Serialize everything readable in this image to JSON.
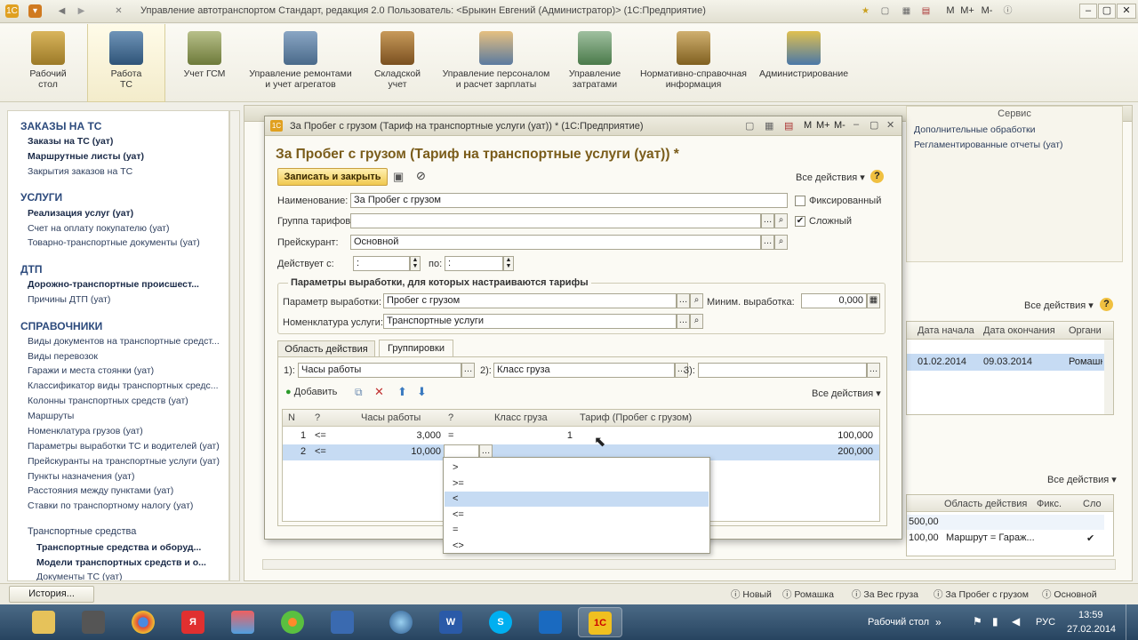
{
  "window": {
    "title": "Управление автотранспортом Стандарт, редакция 2.0    Пользователь: <Брыкин Евгений (Администратор)>    (1С:Предприятие)",
    "btn_m": "M",
    "btn_mplus": "M+",
    "btn_mminus": "M-",
    "logo": "1С"
  },
  "ribbon": [
    {
      "label1": "Рабочий",
      "label2": "стол"
    },
    {
      "label1": "Работа",
      "label2": "ТС"
    },
    {
      "label1": "Учет ГСМ",
      "label2": ""
    },
    {
      "label1": "Управление ремонтами",
      "label2": "и учет агрегатов"
    },
    {
      "label1": "Складской",
      "label2": "учет"
    },
    {
      "label1": "Управление персоналом",
      "label2": "и расчет зарплаты"
    },
    {
      "label1": "Управление",
      "label2": "затратами"
    },
    {
      "label1": "Нормативно-справочная",
      "label2": "информация"
    },
    {
      "label1": "Администрирование",
      "label2": ""
    }
  ],
  "nav": {
    "s1": "ЗАКАЗЫ НА ТС",
    "s1_i1": "Заказы на ТС (уат)",
    "s1_i2": "Маршрутные листы (уат)",
    "s1_i3": "Закрытия заказов на ТС",
    "s2": "УСЛУГИ",
    "s2_i1": "Реализация услуг (уат)",
    "s2_i2": "Счет на оплату покупателю (уат)",
    "s2_i3": "Товарно-транспортные документы (уат)",
    "s3": "ДТП",
    "s3_i1": "Дорожно-транспортные происшест...",
    "s3_i2": "Причины ДТП (уат)",
    "s4": "СПРАВОЧНИКИ",
    "refs": [
      "Виды документов на транспортные средст...",
      "Виды перевозок",
      "Гаражи и места стоянки (уат)",
      "Классификатор виды транспортных средс...",
      "Колонны транспортных средств (уат)",
      "Маршруты",
      "Номенклатура грузов (уат)",
      "Параметры выработки ТС и водителей (уат)",
      "Прейскуранты на транспортные услуги (уат)",
      "Пункты назначения (уат)",
      "Расстояния между пунктами (уат)",
      "Ставки по транспортному налогу (уат)"
    ],
    "s5": "Транспортные средства",
    "s5_i1": "Транспортные средства и оборуд...",
    "s5_i2": "Модели транспортных средств и о...",
    "s5_i3": "Документы ТС (уат)"
  },
  "bg": {
    "title": "За Пробег с грузом (Тариф на транспортные услуги (уат)) * (1С:Предприятие)",
    "service_title": "Сервис",
    "service_1": "Дополнительные обработки",
    "service_2": "Регламентированные отчеты (уат)",
    "all_actions": "Все действия",
    "cols1": [
      "Дата начала",
      "Дата окончания",
      "Органи"
    ],
    "row1": [
      "01.02.2014",
      "09.03.2014",
      "Ромашк"
    ],
    "all_actions2": "Все действия",
    "cols2": [
      "Область действия",
      "Фикс.",
      "Сло"
    ],
    "row2": [
      "500,00",
      "",
      ""
    ],
    "row3": [
      "100,00",
      "Маршрут = Гараж...",
      "✔"
    ]
  },
  "dlg": {
    "title": "За Пробег с грузом (Тариф на транспортные услуги (уат)) * (1С:Предприятие)",
    "heading": "За Пробег с грузом (Тариф на транспортные услуги (уат)) *",
    "save_close": "Записать и закрыть",
    "all_actions": "Все действия",
    "name_label": "Наименование:",
    "name_value": "За Пробег с грузом",
    "group_label": "Группа тарифов:",
    "group_value": "",
    "price_label": "Прейскурант:",
    "price_value": "Основной",
    "valid_label": "Действует с:",
    "valid_from": " :",
    "valid_to_label": "по:",
    "valid_to": " :",
    "fixed_label": "Фиксированный",
    "fixed_checked": false,
    "complex_label": "Сложный",
    "complex_checked": true,
    "params_group": "Параметры выработки, для которых настраиваются тарифы",
    "param_label": "Параметр выработки:",
    "param_value": "Пробег с грузом",
    "min_label": "Миним. выработка:",
    "min_value": "0,000",
    "service_label": "Номенклатура услуги:",
    "service_value": "Транспортные услуги",
    "tab1": "Область действия",
    "tab2": "Группировки",
    "g1_label": "1):",
    "g1_value": "Часы работы",
    "g2_label": "2):",
    "g2_value": "Класс груза",
    "g3_label": "3):",
    "g3_value": "",
    "add": "Добавить",
    "all_actions_tbl": "Все действия",
    "cols": [
      "N",
      "?",
      "Часы работы",
      "?",
      "Класс груза",
      "Тариф (Пробег с грузом)"
    ],
    "rows": [
      [
        "1",
        "<=",
        "3,000",
        "=",
        "1",
        "100,000"
      ],
      [
        "2",
        "<=",
        "10,000",
        "",
        "",
        "200,000"
      ]
    ]
  },
  "popup": [
    ">",
    ">=",
    "<",
    "<=",
    "=",
    "<>"
  ],
  "popup_selected": 2,
  "status": {
    "history": "История...",
    "tabs": [
      "Новый",
      "Ромашка",
      "За Вес груза",
      "За Пробег с грузом",
      "Основной"
    ]
  },
  "tray": {
    "desktop": "Рабочий стол",
    "lang": "РУС",
    "time": "13:59",
    "date": "27.02.2014"
  },
  "colors": {
    "accent": "#7a5c1a",
    "nav_section": "#2c4a7c",
    "selection": "#c6dbf3",
    "taskbar": "#274460"
  },
  "icons": [
    "1c-logo-icon",
    "back-icon",
    "forward-icon",
    "home-icon",
    "star-icon",
    "calc-icon",
    "calendar-icon"
  ]
}
